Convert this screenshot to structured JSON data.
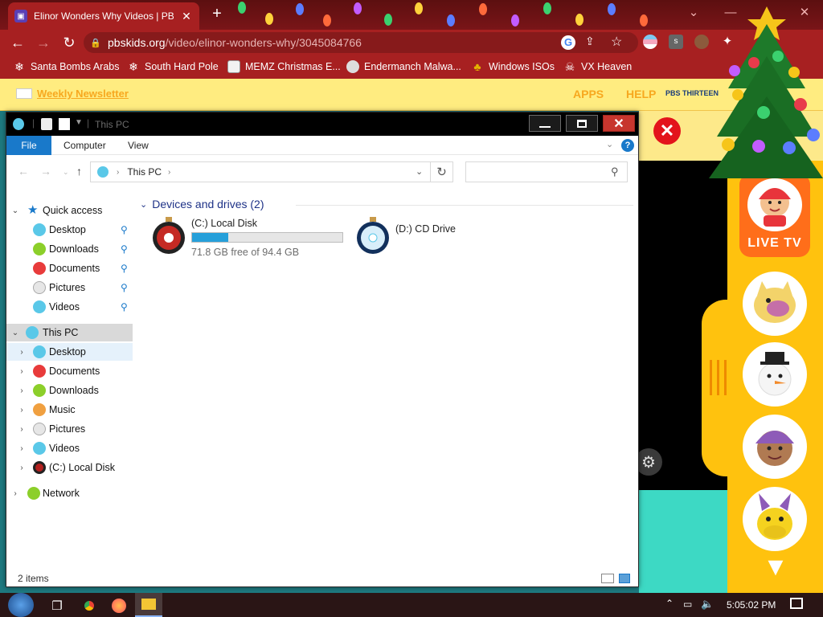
{
  "browser": {
    "tab_title": "Elinor Wonders Why Videos | PBS",
    "url_domain": "pbskids.org",
    "url_path": "/video/elinor-wonders-why/3045084766",
    "new_tab_icon": "plus-icon",
    "bookmarks": [
      {
        "label": "Santa Bombs Arabs",
        "icon": "snowflake-icon"
      },
      {
        "label": "South Hard Pole",
        "icon": "snowflake-icon"
      },
      {
        "label": "MEMZ Christmas E...",
        "icon": "site-icon"
      },
      {
        "label": "Endermanch Malwa...",
        "icon": "raccoon-icon"
      },
      {
        "label": "Windows ISOs",
        "icon": "bell-icon"
      },
      {
        "label": "VX Heaven",
        "icon": "skull-icon"
      }
    ],
    "theme_colors": {
      "frame": "#7a1518",
      "toolbar": "#a72021",
      "omnibox": "#871a1b"
    }
  },
  "pbs": {
    "newsletter": "Weekly Newsletter",
    "apps": "APPS",
    "help": "HELP",
    "station": "PBS THIRTEEN",
    "live_tv": "LIVE TV",
    "shows": [
      "Nature Cat",
      "Snowman",
      "Elinor",
      "Donkey Hodie"
    ]
  },
  "explorer": {
    "title": "This PC",
    "ribbon_tabs": {
      "file": "File",
      "computer": "Computer",
      "view": "View"
    },
    "help": "?",
    "address_segment": "This PC",
    "search_placeholder": "",
    "nav": {
      "quick_access": "Quick access",
      "quick_items": [
        "Desktop",
        "Downloads",
        "Documents",
        "Pictures",
        "Videos"
      ],
      "this_pc": "This PC",
      "this_pc_items": [
        "Desktop",
        "Documents",
        "Downloads",
        "Music",
        "Pictures",
        "Videos",
        "(C:) Local Disk"
      ],
      "network": "Network"
    },
    "group_header": "Devices and drives (2)",
    "drives": [
      {
        "name": "(C:) Local Disk",
        "free_text": "71.8 GB free of 94.4 GB",
        "used_fraction": 0.24
      },
      {
        "name": "(D:) CD Drive"
      }
    ],
    "status": "2 items"
  },
  "taskbar": {
    "time": "5:05:02 PM"
  }
}
